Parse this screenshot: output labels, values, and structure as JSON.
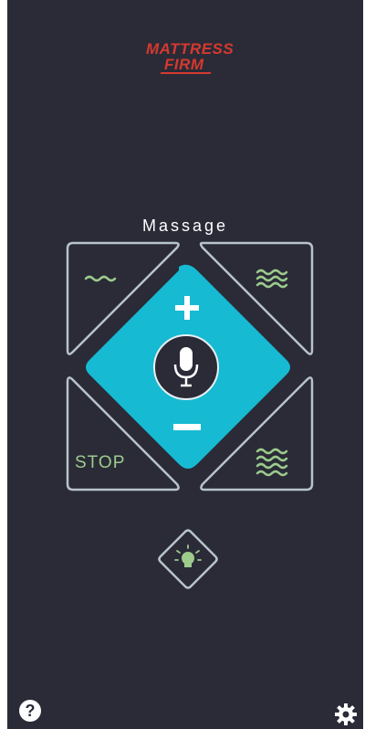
{
  "brand": {
    "line1": "MATTRESS",
    "line2": "FIRM"
  },
  "screen": {
    "title": "Massage"
  },
  "controls": {
    "stop_label": "STOP",
    "increase_icon": "plus-icon",
    "decrease_icon": "minus-icon",
    "voice_icon": "microphone-icon",
    "light_icon": "light-bulb-icon",
    "intensity_low_icon": "wave-low-icon",
    "intensity_medium_icon": "wave-medium-icon",
    "intensity_high_icon": "wave-high-icon"
  },
  "footer": {
    "help_label": "?",
    "settings_icon": "gear-icon"
  },
  "colors": {
    "background": "#2a2b37",
    "accent": "#16bad2",
    "wave": "#9ccb8c",
    "outline": "#b8c3c9",
    "brand": "#d5392f"
  }
}
